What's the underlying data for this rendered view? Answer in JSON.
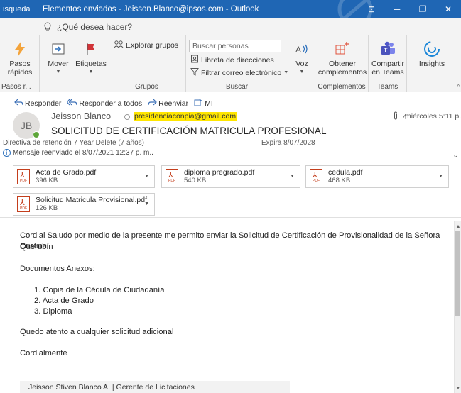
{
  "window": {
    "search_fragment": "isqueda",
    "title": "Elementos enviados - Jeisson.Blanco@ipsos.com - Outlook",
    "buttons": [
      "⊡",
      "─",
      "❐",
      "✕"
    ]
  },
  "tellme": {
    "placeholder": "¿Qué desea hacer?"
  },
  "ribbon": {
    "quicksteps": {
      "label_line1": "Pasos",
      "label_line2": "rápidos",
      "group": "Pasos r..."
    },
    "move": {
      "label": "Mover"
    },
    "tags": {
      "label": "Etiquetas"
    },
    "groups": {
      "explore": "Explorar grupos",
      "group_label": "Grupos"
    },
    "search": {
      "placeholder": "Buscar personas",
      "address_book": "Libreta de direcciones",
      "filter": "Filtrar correo electrónico",
      "group_label": "Buscar"
    },
    "voice": {
      "label": "Voz"
    },
    "addins": {
      "label_line1": "Obtener",
      "label_line2": "complementos",
      "group_label": "Complementos"
    },
    "teams": {
      "label_line1": "Compartir",
      "label_line2": "en Teams",
      "group_label": "Teams"
    },
    "insights": {
      "label": "Insights"
    }
  },
  "message": {
    "actions": {
      "reply": "Responder",
      "reply_all": "Responder a todos",
      "forward": "Reenviar",
      "more": "MI"
    },
    "avatar_initials": "JB",
    "sender": "Jeisson Blanco",
    "to": "presidenciaconpia@gmail.com",
    "attachment_count": "4",
    "date": "miércoles 5:11 p. m",
    "subject": "SOLICITUD DE CERTIFICACIÓN MATRICULA PROFESIONAL",
    "retention": "Directiva de retención   7 Year Delete (7 años)",
    "expires": "Expira   8/07/2028",
    "forwarded": "Mensaje reenviado el 8/07/2021 12:37 p. m.."
  },
  "attachments": [
    {
      "name": "Acta de Grado.pdf",
      "size": "396 KB"
    },
    {
      "name": "diploma pregrado.pdf",
      "size": "540 KB"
    },
    {
      "name": "cedula.pdf",
      "size": "468 KB"
    },
    {
      "name": "Solicitud Matricula Provisional.pdf",
      "size": "126 KB"
    }
  ],
  "body": {
    "line1": "Cordial Saludo por medio de la presente me permito enviar la Solicitud de Certificación de Provisionalidad de la Señora Cristina",
    "line2": "Querubín",
    "annex_title": "Documentos Anexos:",
    "list": [
      "1.   Copia de la Cédula de Ciudadanía",
      "2.   Acta de Grado",
      "3.   Diploma"
    ],
    "closing": "Quedo atento a cualquier solicitud adicional",
    "regards": "Cordialmente",
    "signature": "Jeisson Stiven Blanco A.  |  Gerente de Licitaciones"
  }
}
